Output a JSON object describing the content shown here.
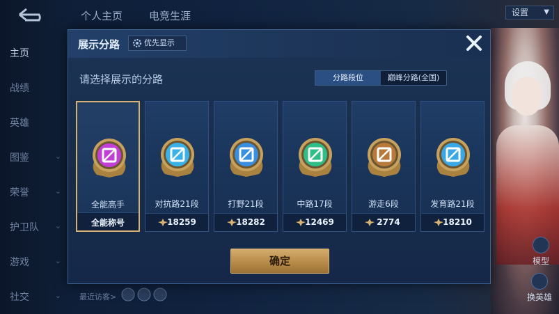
{
  "background": {
    "top_tabs": [
      "个人主页",
      "电竞生涯"
    ],
    "settings_label": "设置",
    "sidebar_items": [
      {
        "label": "主页"
      },
      {
        "label": "战绩"
      },
      {
        "label": "英雄"
      },
      {
        "label": "图鉴"
      },
      {
        "label": "荣誉"
      },
      {
        "label": "护卫队"
      },
      {
        "label": "游戏"
      },
      {
        "label": "社交"
      }
    ],
    "recent_visitors_label": "最近访客>",
    "right_buttons": [
      {
        "label": "模型",
        "icon": "model-icon"
      },
      {
        "label": "换英雄",
        "icon": "swap-hero-icon"
      }
    ]
  },
  "modal": {
    "title": "展示分路",
    "priority_button": {
      "label": "优先显示",
      "icon": "gear-icon"
    },
    "close_icon": "close-icon",
    "subtitle": "请选择展示的分路",
    "segment_options": [
      "分路段位",
      "巅峰分路(全国)"
    ],
    "segment_selected": "分路段位",
    "cards": [
      {
        "name": "全能高手",
        "footer": "全能称号",
        "emblem_color": "#c23fd6",
        "selected": true
      },
      {
        "name": "对抗路21段",
        "score": "18259",
        "emblem_color": "#3ab2e8",
        "selected": false
      },
      {
        "name": "打野21段",
        "score": "18282",
        "emblem_color": "#3a8ee0",
        "selected": false
      },
      {
        "name": "中路17段",
        "score": "12469",
        "emblem_color": "#2fbf86",
        "selected": false
      },
      {
        "name": "游走6段",
        "score": "2774",
        "emblem_color": "#b87a3a",
        "selected": false
      },
      {
        "name": "发育路21段",
        "score": "18210",
        "emblem_color": "#3aa8e6",
        "selected": false
      }
    ],
    "confirm_label": "确定"
  },
  "colors": {
    "accent_gold": "#d7b273",
    "panel_bg": "#1c3456",
    "selected_seg": "#2b4f82"
  }
}
